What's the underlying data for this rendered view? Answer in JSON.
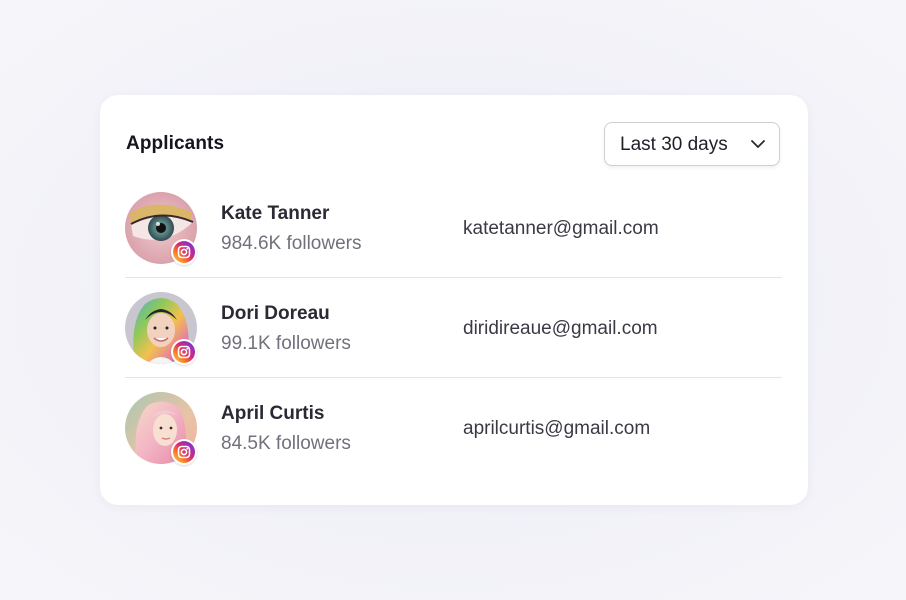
{
  "card": {
    "title": "Applicants"
  },
  "filter": {
    "selected": "Last 30 days",
    "icon": "chevron-down-icon"
  },
  "applicants": [
    {
      "name": "Kate Tanner",
      "followers": "984.6K followers",
      "email": "katetanner@gmail.com",
      "platform_icon": "instagram-icon"
    },
    {
      "name": "Dori Doreau",
      "followers": "99.1K followers",
      "email": "diridireaue@gmail.com",
      "platform_icon": "instagram-icon"
    },
    {
      "name": "April Curtis",
      "followers": "84.5K followers",
      "email": "aprilcurtis@gmail.com",
      "platform_icon": "instagram-icon"
    }
  ],
  "colors": {
    "background": "#f1f1f8",
    "card": "#ffffff",
    "title": "#15151f",
    "secondary_text": "#71717c",
    "divider": "#e4e4ea"
  }
}
